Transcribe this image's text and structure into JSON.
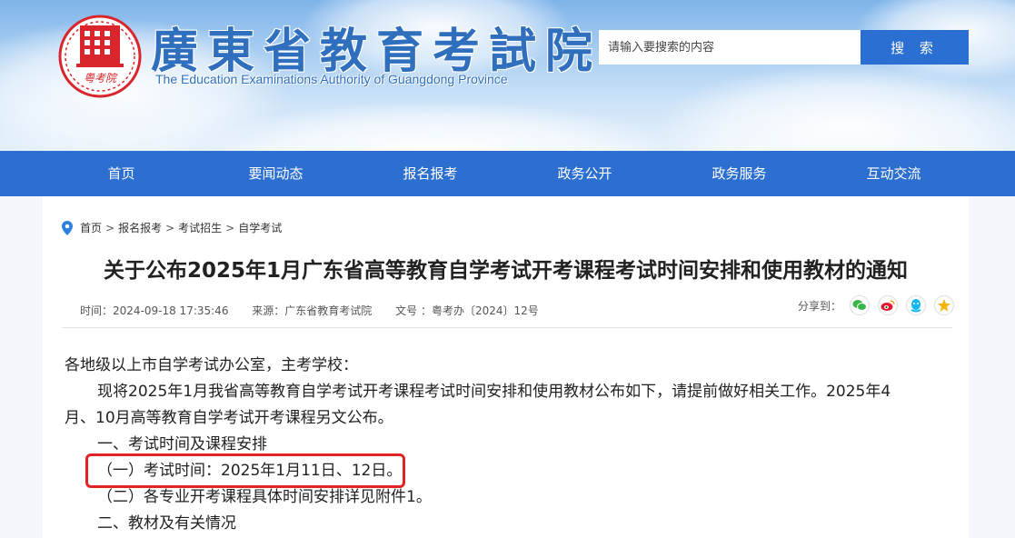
{
  "header": {
    "title": "廣東省教育考試院",
    "subtitle": "The Education Examinations Authority of Guangdong Province",
    "logo_text": "粤考院",
    "search": {
      "placeholder": "请输入要搜索的内容",
      "button_label": "搜 索"
    }
  },
  "nav": {
    "items": [
      {
        "label": "首页"
      },
      {
        "label": "要闻动态"
      },
      {
        "label": "报名报考"
      },
      {
        "label": "政务公开"
      },
      {
        "label": "政务服务"
      },
      {
        "label": "互动交流"
      }
    ]
  },
  "breadcrumb": {
    "items": [
      "首页",
      "报名报考",
      "考试招生",
      "自学考试"
    ],
    "separator": ">"
  },
  "article": {
    "title": "关于公布2025年1月广东省高等教育自学考试开考课程考试时间安排和使用教材的通知",
    "meta": {
      "time": "时间：2024-09-18 17:35:46",
      "source": "来源：广东省教育考试院",
      "doc_no": "文号 ：粤考办〔2024〕12号"
    },
    "share": {
      "label": "分享到：",
      "icons": [
        "wechat-icon",
        "weibo-icon",
        "qq-icon",
        "qzone-icon"
      ]
    },
    "paragraphs": {
      "p1": "各地级以上市自学考试办公室，主考学校：",
      "p2a": "现将2025年1月我省高等教育自学考试开考课程考试时间安排和使用教材公布如下，请提前做好相关工作。2025年4",
      "p2b": "月、10月高等教育自学考试开考课程另文公布。",
      "p3": "一、考试时间及课程安排",
      "p4": "（一）考试时间：2025年1月11日、12日。",
      "p5": "（二）各专业开考课程具体时间安排详见附件1。",
      "p6": "二、教材及有关情况"
    }
  },
  "colors": {
    "nav_bg": "#2c6fd0",
    "search_button": "#2a6fd1",
    "brand_blue": "#2f6fbd",
    "logo_red": "#d9252b",
    "highlight_border": "#e02424"
  }
}
